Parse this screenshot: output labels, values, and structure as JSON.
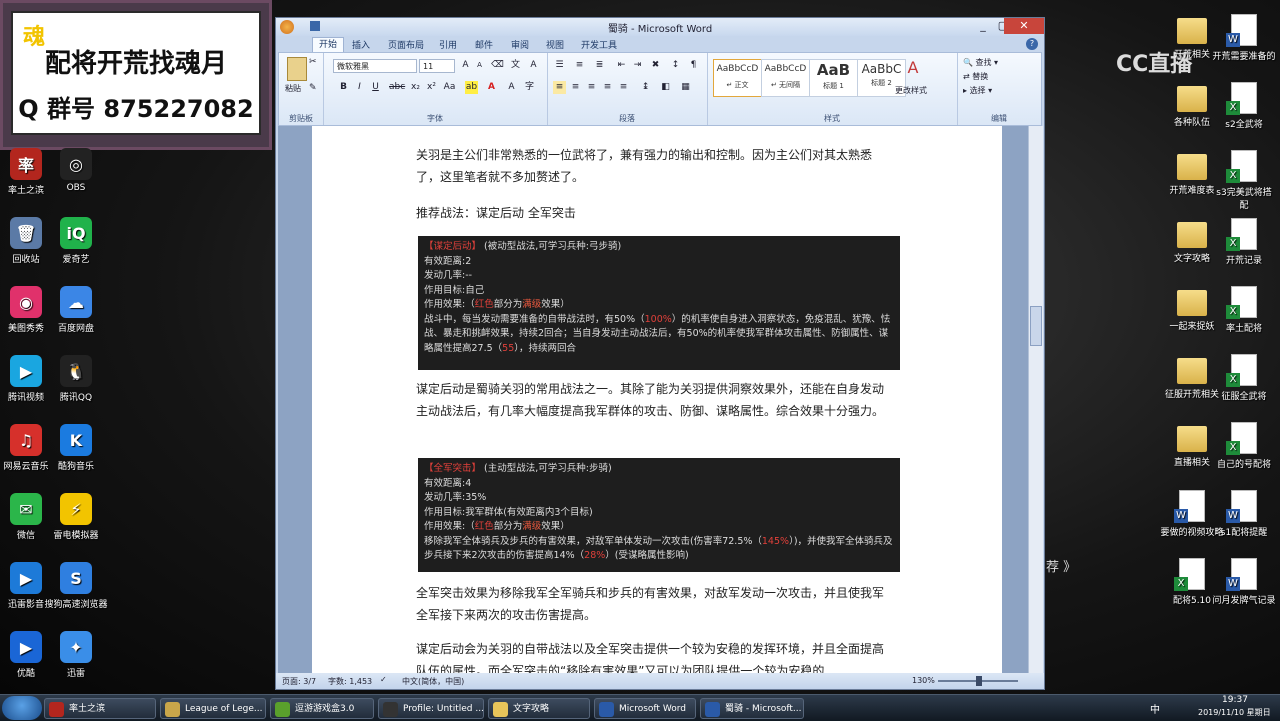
{
  "banner": {
    "corner": "魂",
    "line1": "配将开荒找魂月",
    "line2": "Q 群号 875227082"
  },
  "watermark": "CC直播",
  "left_icons": [
    {
      "label": "率土之滨",
      "color": "#b3261e",
      "glyph": "率"
    },
    {
      "label": "OBS",
      "color": "#222",
      "glyph": "◎"
    },
    {
      "label": "回收站",
      "color": "#5b7aa6",
      "glyph": "🗑"
    },
    {
      "label": "爱奇艺",
      "color": "#20b24b",
      "glyph": "iQ"
    },
    {
      "label": "美图秀秀",
      "color": "#e0316b",
      "glyph": "◉"
    },
    {
      "label": "百度网盘",
      "color": "#3b86e6",
      "glyph": "☁"
    },
    {
      "label": "腾讯视频",
      "color": "#1aa6e0",
      "glyph": "▶"
    },
    {
      "label": "腾讯QQ",
      "color": "#222",
      "glyph": "🐧"
    },
    {
      "label": "网易云音乐",
      "color": "#d6302b",
      "glyph": "♫"
    },
    {
      "label": "酷狗音乐",
      "color": "#1b7be0",
      "glyph": "K"
    },
    {
      "label": "微信",
      "color": "#2bb64a",
      "glyph": "✉"
    },
    {
      "label": "雷电模拟器",
      "color": "#f2c400",
      "glyph": "⚡"
    },
    {
      "label": "迅雷影音",
      "color": "#1d7ad8",
      "glyph": "▶"
    },
    {
      "label": "搜狗高速浏览器",
      "color": "#2f7fe0",
      "glyph": "S"
    },
    {
      "label": "优酷",
      "color": "#1a66d6",
      "glyph": "▶"
    },
    {
      "label": "迅雷",
      "color": "#3a8ee8",
      "glyph": "✦"
    }
  ],
  "right_icons": [
    {
      "label": "开荒相关",
      "type": "folder"
    },
    {
      "label": "开荒需要准备的",
      "type": "doc"
    },
    {
      "label": "各种队伍",
      "type": "folder"
    },
    {
      "label": "s2全武将",
      "type": "docx"
    },
    {
      "label": "开荒难度表",
      "type": "folder"
    },
    {
      "label": "s3完美武将搭配",
      "type": "docx"
    },
    {
      "label": "文字攻略",
      "type": "folder"
    },
    {
      "label": "开荒记录",
      "type": "docx"
    },
    {
      "label": "一起来捉妖",
      "type": "folder"
    },
    {
      "label": "率土配将",
      "type": "docx"
    },
    {
      "label": "征服开荒相关",
      "type": "folder"
    },
    {
      "label": "征服全武将",
      "type": "docx"
    },
    {
      "label": "直播相关",
      "type": "folder"
    },
    {
      "label": "自己的号配将",
      "type": "docx"
    },
    {
      "label": "要做的视频攻略",
      "type": "doc"
    },
    {
      "label": "s1配将提醒",
      "type": "doc"
    },
    {
      "label": "配将5.10",
      "type": "docx"
    },
    {
      "label": "问月发牌气记录",
      "type": "doc"
    }
  ],
  "word": {
    "title": "蜀骑 - Microsoft Word",
    "tabs": [
      "开始",
      "插入",
      "页面布局",
      "引用",
      "邮件",
      "审阅",
      "视图",
      "开发工具"
    ],
    "font_name": "微软雅黑",
    "font_size": "11",
    "clipboard_label": "剪贴板",
    "paste_label": "粘贴",
    "font_label": "字体",
    "para_label": "段落",
    "styles_label": "样式",
    "edit_label": "编辑",
    "styles": [
      {
        "sample": "AaBbCcD",
        "name": "↵ 正文"
      },
      {
        "sample": "AaBbCcD",
        "name": "↵ 无间隔"
      },
      {
        "sample": "AaB",
        "name": "标题 1"
      },
      {
        "sample": "AaBbC",
        "name": "标题 2"
      }
    ],
    "change_styles": "更改样式",
    "find": "查找",
    "replace": "替换",
    "select": "选择",
    "doc": {
      "p1": "关羽是主公们非常熟悉的一位武将了，兼有强力的输出和控制。因为主公们对其太熟悉了，这里笔者就不多加赘述了。",
      "p2": "推荐战法：谋定后动 全军突击",
      "box1": {
        "name": "【谋定后动】",
        "type": "(被动型战法,可学习兵种:弓步骑)",
        "range": "有效距离:2",
        "chance": "发动几率:--",
        "target": "作用目标:自己",
        "effect_a": "作用效果:（",
        "effect_red": "红色",
        "effect_b": "部分为",
        "effect_full": "满级",
        "effect_c": "效果）",
        "desc1": "战斗中，每当发动需要准备的自带战法时，有50%（",
        "desc1_red": "100%",
        "desc1b": "）的机率使自身进入洞察状态，免疫混乱、犹豫、怯战、暴走和挑衅效果，持续2回合；当自身发动主动战法后，有50%的机率使我军群体攻击属性、防御属性、谋略属性提高27.5（",
        "desc1_red2": "55",
        "desc1c": "），持续两回合"
      },
      "p3": "谋定后动是蜀骑关羽的常用战法之一。其除了能为关羽提供洞察效果外，还能在自身发动主动战法后，有几率大幅度提高我军群体的攻击、防御、谋略属性。综合效果十分强力。",
      "box2": {
        "name": "【全军突击】",
        "type": "(主动型战法,可学习兵种:步骑)",
        "range": "有效距离:4",
        "chance": "发动几率:35%",
        "target": "作用目标:我军群体(有效距离内3个目标)",
        "effect_a": "作用效果:（",
        "effect_red": "红色",
        "effect_b": "部分为",
        "effect_full": "满级",
        "effect_c": "效果）",
        "desc1": "移除我军全体骑兵及步兵的有害效果，对敌军单体发动一次攻击(伤害率72.5%（",
        "desc1_red": "145%",
        "desc1b": "）)，并使我军全体骑兵及步兵接下来2次攻击的伤害提高14%（",
        "desc1_red2": "28%",
        "desc1c": "）(受谋略属性影响)"
      },
      "p4": "全军突击效果为移除我军全军骑兵和步兵的有害效果，对敌军发动一次攻击，并且使我军全军接下来两次的攻击伤害提高。",
      "p5": "谋定后动会为关羽的自带战法以及全军突击提供一个较为安稳的发挥环境，并且全面提高队伍的属性。而全军突击的“移除有害效果”又可以为团队提供一个较为安稳的"
    },
    "status": {
      "page": "页面: 3/7",
      "words": "字数: 1,453",
      "lang": "中文(简体，中国)",
      "zoom": "130%"
    }
  },
  "taskbar": {
    "items": [
      {
        "label": "率土之滨",
        "color": "#b3261e"
      },
      {
        "label": "League of Lege...",
        "color": "#c9a64a"
      },
      {
        "label": "逗游游戏盒3.0",
        "color": "#5aa02c"
      },
      {
        "label": "Profile: Untitled ...",
        "color": "#333"
      },
      {
        "label": "文字攻略",
        "color": "#e8c55a"
      },
      {
        "label": "Microsoft Word",
        "color": "#2a5aa8"
      },
      {
        "label": "蜀骑 - Microsoft...",
        "color": "#2a5aa8"
      }
    ],
    "ime": "中",
    "time": "19:37",
    "date": "2019/11/10 星期日"
  },
  "side_text": "荐 》"
}
